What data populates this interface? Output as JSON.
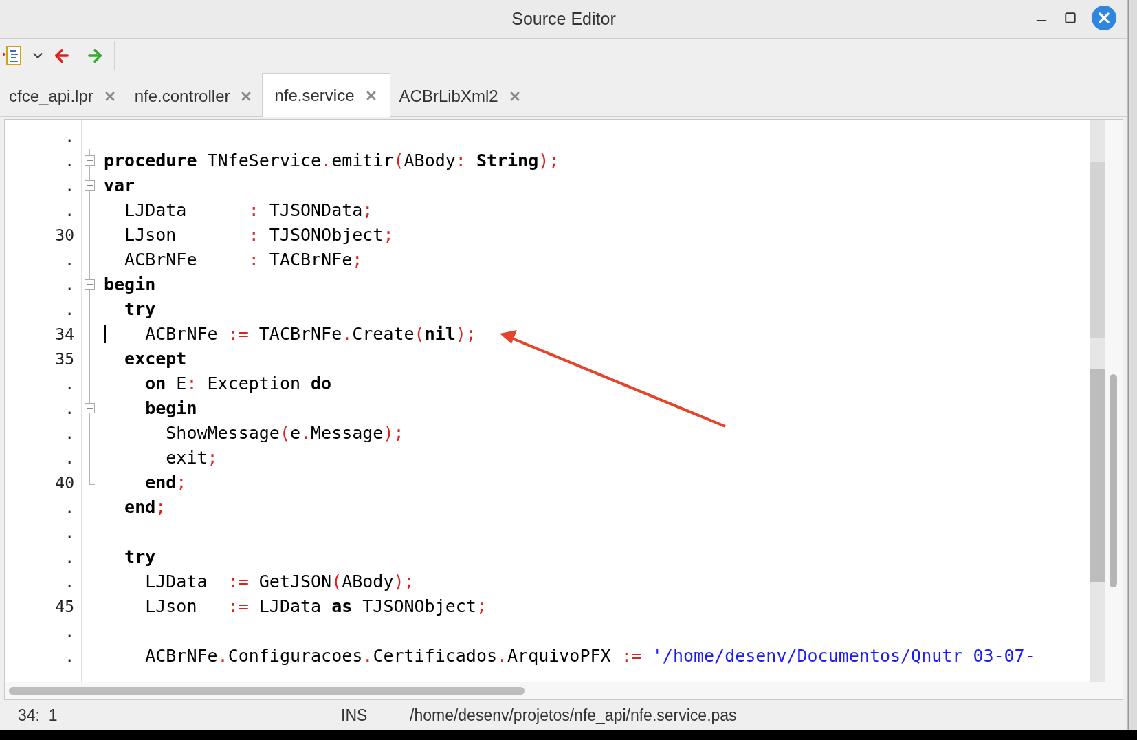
{
  "window": {
    "title": "Source Editor"
  },
  "tabs": [
    {
      "label": "cfce_api.lpr",
      "selected": false
    },
    {
      "label": "nfe.controller",
      "selected": false
    },
    {
      "label": "nfe.service",
      "selected": true
    },
    {
      "label": "ACBrLibXml2",
      "selected": false
    }
  ],
  "editor": {
    "lines": [
      {
        "number": ".",
        "foldable": false,
        "caret": false
      },
      {
        "number": ".",
        "foldable": true,
        "caret": false,
        "tokens": [
          {
            "text": "procedure",
            "kind": "kw"
          },
          {
            "text": " TNfeService",
            "kind": "id"
          },
          {
            "text": ".",
            "kind": "sym"
          },
          {
            "text": "emitir",
            "kind": "id"
          },
          {
            "text": "(",
            "kind": "sym"
          },
          {
            "text": "ABody",
            "kind": "id"
          },
          {
            "text": ": ",
            "kind": "sym"
          },
          {
            "text": "String",
            "kind": "kw"
          },
          {
            "text": ");",
            "kind": "sym"
          }
        ]
      },
      {
        "number": ".",
        "foldable": true,
        "caret": false,
        "tokens": [
          {
            "text": "var",
            "kind": "kw"
          }
        ]
      },
      {
        "number": ".",
        "foldable": false,
        "caret": false,
        "tokens": [
          {
            "text": "  LJData      ",
            "kind": "id"
          },
          {
            "text": ":",
            "kind": "sym"
          },
          {
            "text": " TJSONData",
            "kind": "id"
          },
          {
            "text": ";",
            "kind": "sym"
          }
        ]
      },
      {
        "number": "30",
        "foldable": false,
        "caret": false,
        "tokens": [
          {
            "text": "  LJson       ",
            "kind": "id"
          },
          {
            "text": ":",
            "kind": "sym"
          },
          {
            "text": " TJSONObject",
            "kind": "id"
          },
          {
            "text": ";",
            "kind": "sym"
          }
        ]
      },
      {
        "number": ".",
        "foldable": false,
        "caret": false,
        "tokens": [
          {
            "text": "  ACBrNFe     ",
            "kind": "id"
          },
          {
            "text": ":",
            "kind": "sym"
          },
          {
            "text": " TACBrNFe",
            "kind": "id"
          },
          {
            "text": ";",
            "kind": "sym"
          }
        ]
      },
      {
        "number": ".",
        "foldable": true,
        "caret": false,
        "tokens": [
          {
            "text": "begin",
            "kind": "kw"
          }
        ]
      },
      {
        "number": ".",
        "foldable": false,
        "caret": false,
        "tokens": [
          {
            "text": "  try",
            "kind": "kw"
          }
        ]
      },
      {
        "number": "34",
        "foldable": false,
        "caret": true,
        "tokens": [
          {
            "text": "    ACBrNFe ",
            "kind": "id"
          },
          {
            "text": ":=",
            "kind": "sym"
          },
          {
            "text": " TACBrNFe",
            "kind": "id"
          },
          {
            "text": ".",
            "kind": "sym"
          },
          {
            "text": "Create",
            "kind": "id"
          },
          {
            "text": "(",
            "kind": "sym"
          },
          {
            "text": "nil",
            "kind": "kw"
          },
          {
            "text": ");",
            "kind": "sym"
          }
        ]
      },
      {
        "number": "35",
        "foldable": false,
        "caret": false,
        "tokens": [
          {
            "text": "  except",
            "kind": "kw"
          }
        ]
      },
      {
        "number": ".",
        "foldable": false,
        "caret": false,
        "tokens": [
          {
            "text": "    on",
            "kind": "kw"
          },
          {
            "text": " E",
            "kind": "id"
          },
          {
            "text": ":",
            "kind": "sym"
          },
          {
            "text": " Exception ",
            "kind": "id"
          },
          {
            "text": "do",
            "kind": "kw"
          }
        ]
      },
      {
        "number": ".",
        "foldable": true,
        "caret": false,
        "tokens": [
          {
            "text": "    begin",
            "kind": "kw"
          }
        ]
      },
      {
        "number": ".",
        "foldable": false,
        "caret": false,
        "tokens": [
          {
            "text": "      ShowMessage",
            "kind": "id"
          },
          {
            "text": "(",
            "kind": "sym"
          },
          {
            "text": "e",
            "kind": "id"
          },
          {
            "text": ".",
            "kind": "sym"
          },
          {
            "text": "Message",
            "kind": "id"
          },
          {
            "text": ");",
            "kind": "sym"
          }
        ]
      },
      {
        "number": ".",
        "foldable": false,
        "caret": false,
        "tokens": [
          {
            "text": "      exit",
            "kind": "id"
          },
          {
            "text": ";",
            "kind": "sym"
          }
        ]
      },
      {
        "number": "40",
        "foldable": false,
        "caret": false,
        "tokens": [
          {
            "text": "    end",
            "kind": "kw"
          },
          {
            "text": ";",
            "kind": "sym"
          }
        ]
      },
      {
        "number": ".",
        "foldable": false,
        "caret": false,
        "tokens": [
          {
            "text": "  end",
            "kind": "kw"
          },
          {
            "text": ";",
            "kind": "sym"
          }
        ]
      },
      {
        "number": ".",
        "foldable": false,
        "caret": false
      },
      {
        "number": ".",
        "foldable": false,
        "caret": false,
        "tokens": [
          {
            "text": "  try",
            "kind": "kw"
          }
        ]
      },
      {
        "number": ".",
        "foldable": false,
        "caret": false,
        "tokens": [
          {
            "text": "    LJData  ",
            "kind": "id"
          },
          {
            "text": ":=",
            "kind": "sym"
          },
          {
            "text": " GetJSON",
            "kind": "id"
          },
          {
            "text": "(",
            "kind": "sym"
          },
          {
            "text": "ABody",
            "kind": "id"
          },
          {
            "text": ");",
            "kind": "sym"
          }
        ]
      },
      {
        "number": "45",
        "foldable": false,
        "caret": false,
        "tokens": [
          {
            "text": "    LJson   ",
            "kind": "id"
          },
          {
            "text": ":=",
            "kind": "sym"
          },
          {
            "text": " LJData ",
            "kind": "id"
          },
          {
            "text": "as",
            "kind": "kw"
          },
          {
            "text": " TJSONObject",
            "kind": "id"
          },
          {
            "text": ";",
            "kind": "sym"
          }
        ]
      },
      {
        "number": ".",
        "foldable": false,
        "caret": false
      },
      {
        "number": ".",
        "foldable": false,
        "caret": false,
        "tokens": [
          {
            "text": "    ACBrNFe",
            "kind": "id"
          },
          {
            "text": ".",
            "kind": "sym"
          },
          {
            "text": "Configuracoes",
            "kind": "id"
          },
          {
            "text": ".",
            "kind": "sym"
          },
          {
            "text": "Certificados",
            "kind": "id"
          },
          {
            "text": ".",
            "kind": "sym"
          },
          {
            "text": "ArquivoPFX ",
            "kind": "id"
          },
          {
            "text": ":=",
            "kind": "sym"
          },
          {
            "text": " '/home/desenv/Documentos/Qnutr 03-07-",
            "kind": "str"
          }
        ]
      }
    ]
  },
  "status_bar": {
    "position": "34:  1",
    "mode": "INS",
    "file": "/home/desenv/projetos/nfe_api/nfe.service.pas"
  }
}
